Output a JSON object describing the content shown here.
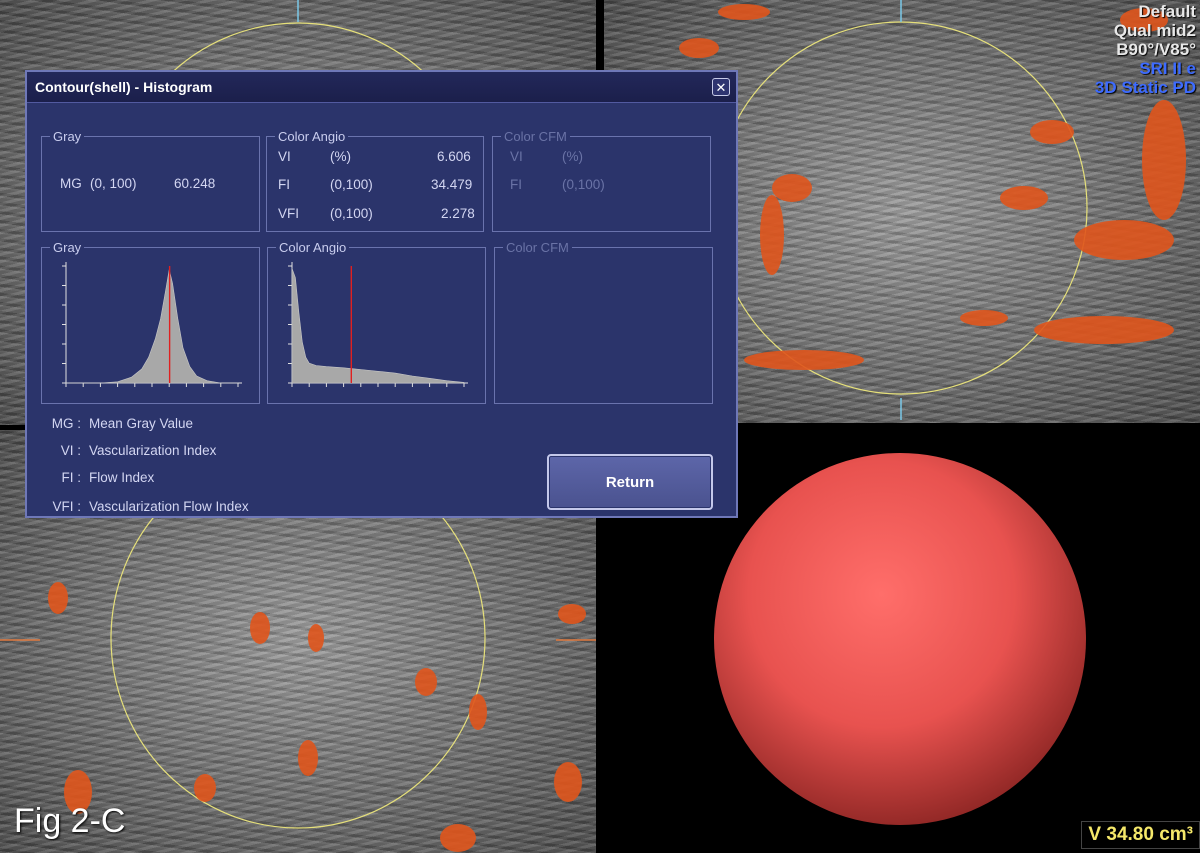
{
  "overlay": {
    "info_lines": [
      "Default",
      "Qual mid2",
      "B90°/V85°",
      "SRI II e",
      "3D Static PD"
    ],
    "fig_label": "Fig 2-C",
    "volume": "V 34.80 cm³"
  },
  "dialog": {
    "title": "Contour(shell) - Histogram",
    "close_glyph": "✕",
    "gray_stats": {
      "title": "Gray",
      "rows": [
        {
          "abbr": "MG",
          "range": "(0, 100)",
          "value": "60.248"
        }
      ]
    },
    "angio_stats": {
      "title": "Color Angio",
      "rows": [
        {
          "abbr": "VI",
          "range": "(%)",
          "value": "6.606"
        },
        {
          "abbr": "FI",
          "range": "(0,100)",
          "value": "34.479"
        },
        {
          "abbr": "VFI",
          "range": "(0,100)",
          "value": "2.278"
        }
      ]
    },
    "cfm_stats": {
      "title": "Color CFM",
      "rows": [
        {
          "abbr": "VI",
          "range": "(%)"
        },
        {
          "abbr": "FI",
          "range": "(0,100)"
        }
      ]
    },
    "gray_hist_title": "Gray",
    "angio_hist_title": "Color Angio",
    "cfm_hist_title": "Color CFM",
    "legend": [
      {
        "abbr": "MG :",
        "text": "Mean Gray Value"
      },
      {
        "abbr": "VI :",
        "text": "Vascularization Index"
      },
      {
        "abbr": "FI :",
        "text": "Flow Index"
      },
      {
        "abbr": "VFI :",
        "text": "Vascularization Flow Index"
      }
    ],
    "return_label": "Return"
  },
  "colors": {
    "dialog_bg": "#2b346b",
    "sphere": "#e8524f",
    "contour": "#e6e07a",
    "flow": "#e0551c",
    "volume_text": "#f5e86a"
  },
  "chart_data": [
    {
      "type": "area",
      "title": "Gray",
      "description_values": {
        "mean_marker": 60.248
      },
      "xlim": [
        0,
        100
      ],
      "x": [
        0,
        20,
        30,
        38,
        44,
        48,
        52,
        55,
        58,
        60,
        62,
        65,
        68,
        72,
        76,
        82,
        90,
        100
      ],
      "values": [
        0,
        0,
        0.01,
        0.05,
        0.12,
        0.22,
        0.38,
        0.55,
        0.8,
        0.97,
        0.85,
        0.55,
        0.3,
        0.14,
        0.06,
        0.02,
        0,
        0
      ]
    },
    {
      "type": "area",
      "title": "Color Angio",
      "description_values": {
        "mean_marker": 34.479
      },
      "xlim": [
        0,
        100
      ],
      "x": [
        0,
        2,
        4,
        6,
        8,
        10,
        14,
        20,
        30,
        40,
        50,
        60,
        70,
        80,
        90,
        100
      ],
      "values": [
        0.98,
        0.9,
        0.6,
        0.35,
        0.22,
        0.17,
        0.15,
        0.14,
        0.13,
        0.115,
        0.1,
        0.085,
        0.06,
        0.04,
        0.02,
        0.005
      ]
    }
  ]
}
